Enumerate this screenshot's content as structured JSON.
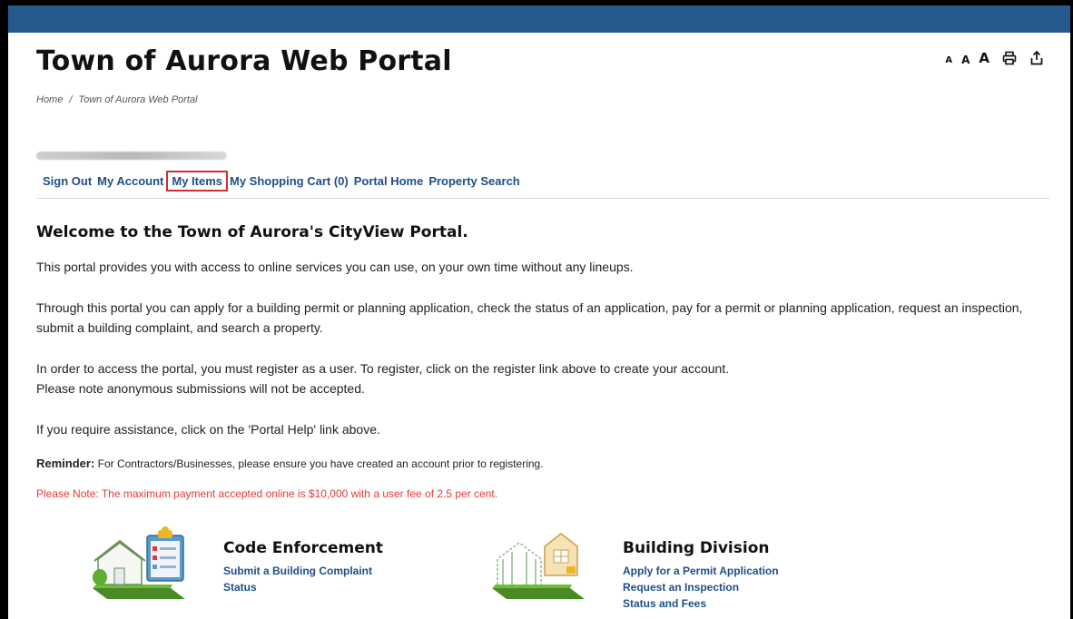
{
  "header": {
    "title": "Town of Aurora Web Portal",
    "tools": {
      "font_small": "A",
      "font_medium": "A",
      "font_large": "A",
      "print_icon": "printer-icon",
      "share_icon": "share-icon"
    }
  },
  "breadcrumb": {
    "home": "Home",
    "separator": "/",
    "current": "Town of Aurora Web Portal"
  },
  "nav": {
    "sign_out": "Sign Out",
    "my_account": "My Account",
    "my_items": "My Items",
    "shopping_cart": "My Shopping Cart (0)",
    "portal_home": "Portal Home",
    "property_search": "Property Search"
  },
  "content": {
    "welcome": "Welcome to the Town of Aurora's CityView Portal.",
    "p1": "This portal provides you with access to online services you can use, on your own time without any lineups.",
    "p2": "Through this portal you can apply for a building permit or planning application, check the status of an application, pay for a permit or planning application, request an inspection, submit a building complaint, and search a property.",
    "p3a": "In order to access the portal, you must register as a user. To register, click on the register link above to create your account.",
    "p3b": "Please note anonymous submissions will not be accepted.",
    "p4": "If you require assistance, click on the 'Portal Help' link above.",
    "reminder_label": "Reminder:",
    "reminder_text": " For Contractors/Businesses, please ensure you have created an account prior to registering.",
    "note": "Please Note: The maximum payment accepted online is $10,000 with a user fee of 2.5 per cent."
  },
  "services": [
    {
      "title": "Code Enforcement",
      "icon": "code-enforcement-icon",
      "links": [
        "Submit a Building Complaint",
        "Status"
      ]
    },
    {
      "title": "Building Division",
      "icon": "building-division-icon",
      "links": [
        "Apply for a Permit Application",
        "Request an Inspection",
        "Status and Fees"
      ]
    }
  ],
  "colors": {
    "topbar": "#265a8f",
    "link": "#1d4f87",
    "highlight_box": "#d32f2f",
    "warning": "#e53935"
  }
}
